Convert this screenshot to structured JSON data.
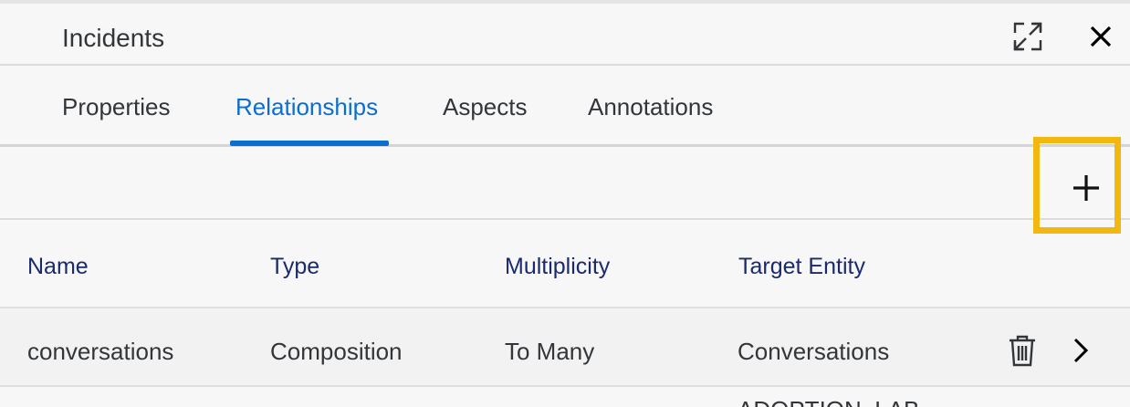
{
  "header": {
    "title": "Incidents"
  },
  "icons": {
    "expand": "expand-icon",
    "close": "close-icon",
    "add": "plus-icon",
    "delete": "trash-icon",
    "navigate": "chevron-right-icon"
  },
  "tabs": [
    {
      "label": "Properties"
    },
    {
      "label": "Relationships",
      "active": true
    },
    {
      "label": "Aspects"
    },
    {
      "label": "Annotations"
    }
  ],
  "table": {
    "columns": [
      "Name",
      "Type",
      "Multiplicity",
      "Target Entity"
    ],
    "rows": [
      {
        "name": "conversations",
        "type": "Composition",
        "multiplicity": "To Many",
        "target": "Conversations"
      },
      {
        "target": "ADOPTION_LAB"
      }
    ]
  },
  "colors": {
    "accent": "#0a6ed1",
    "highlight": "#f3b810",
    "header_text": "#1a2a6c"
  }
}
